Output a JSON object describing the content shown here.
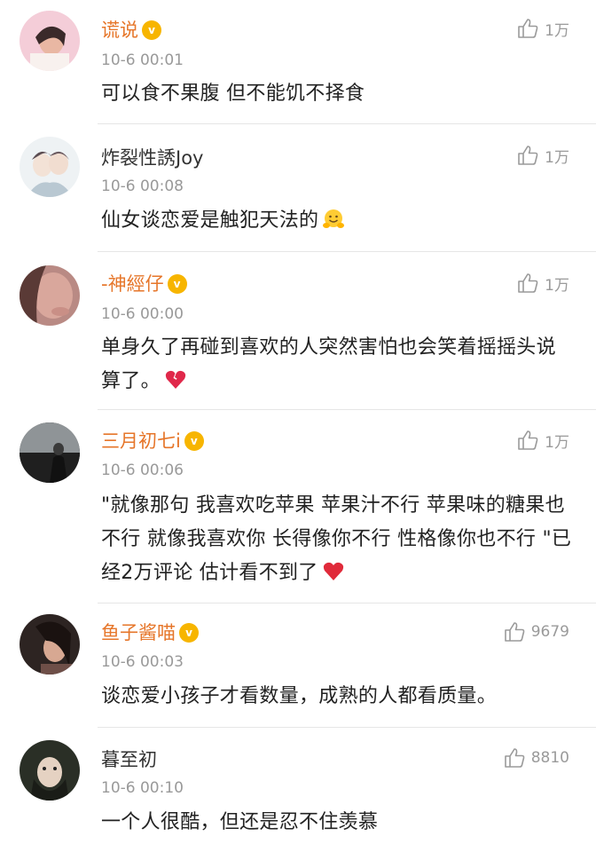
{
  "comments": [
    {
      "name": "谎说",
      "vip": true,
      "time": "10-6 00:01",
      "likes": "1万",
      "text": "可以食不果腹 但不能饥不择食",
      "avatar_icon": "avatar-pink-girl-icon"
    },
    {
      "name": "炸裂性誘Joy",
      "vip": false,
      "time": "10-6 00:08",
      "likes": "1万",
      "text": "仙女谈恋爱是触犯天法的",
      "emoji": "hugging-face-emoji",
      "avatar_icon": "avatar-couple-sketch-icon"
    },
    {
      "name": "-神經仔",
      "vip": true,
      "time": "10-6 00:00",
      "likes": "1万",
      "text": "单身久了再碰到喜欢的人突然害怕也会笑着摇摇头说算了。",
      "emoji": "broken-heart-emoji",
      "avatar_icon": "avatar-face-closeup-icon"
    },
    {
      "name": "三月初七i",
      "vip": true,
      "time": "10-6 00:06",
      "likes": "1万",
      "text": "\"就像那句 我喜欢吃苹果 苹果汁不行 苹果味的糖果也不行 就像我喜欢你 长得像你不行 性格像你也不行 \"已经2万评论 估计看不到了",
      "emoji": "red-heart-emoji",
      "avatar_icon": "avatar-seaside-figure-icon"
    },
    {
      "name": "鱼子酱喵",
      "vip": true,
      "time": "10-6 00:03",
      "likes": "9679",
      "text": "谈恋爱小孩子才看数量，成熟的人都看质量。",
      "avatar_icon": "avatar-dark-hair-girl-icon"
    },
    {
      "name": "暮至初",
      "vip": false,
      "time": "10-6 00:10",
      "likes": "8810",
      "text": "一个人很酷，但还是忍不住羡慕",
      "avatar_icon": "avatar-upside-down-face-icon"
    }
  ],
  "vip_badge_text": "v",
  "like_icon": "thumbs-up-icon"
}
